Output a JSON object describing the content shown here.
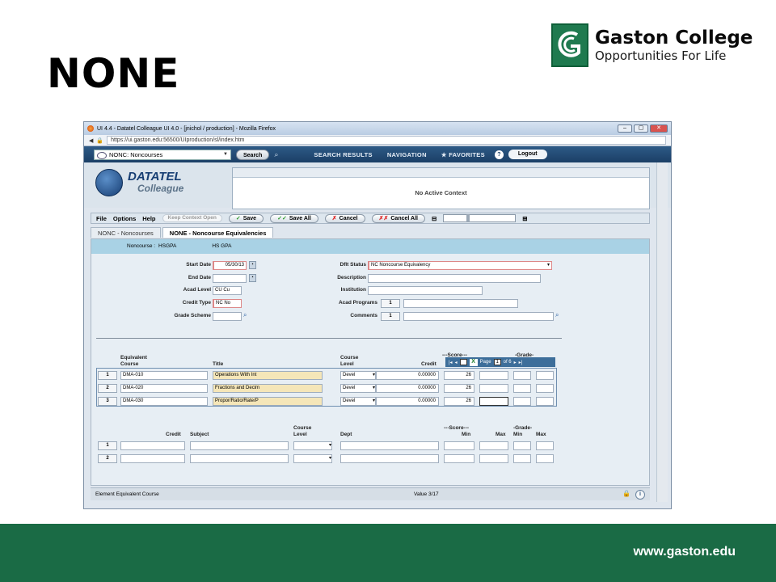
{
  "slide": {
    "title": "NONE",
    "logo_name": "Gaston College",
    "logo_tagline": "Opportunities For Life",
    "footer_url": "www.gaston.edu"
  },
  "browser": {
    "window_title": "UI 4.4 - Datatel Colleague UI 4.0 - [jnichol / production] - Mozilla Firefox",
    "url": "https://ui.gaston.edu:56500/UIproduction/sl/index.htm"
  },
  "appbar": {
    "mnemonic_value": "NONC: Noncourses",
    "search_label": "Search",
    "search_results": "SEARCH RESULTS",
    "navigation": "NAVIGATION",
    "favorites": "FAVORITES",
    "logout": "Logout"
  },
  "branding": {
    "datatel": "DATATEL",
    "colleague": "Colleague",
    "context": "No Active Context"
  },
  "menu": {
    "file": "File",
    "options": "Options",
    "help": "Help",
    "keep_context": "Keep Context Open",
    "save": "Save",
    "save_all": "Save All",
    "cancel": "Cancel",
    "cancel_all": "Cancel All"
  },
  "tabs": [
    "NONC - Noncourses",
    "NONE - Noncourse Equivalencies"
  ],
  "record": {
    "label": "Noncourse :",
    "code": "HSGPA",
    "desc": "HS GPA"
  },
  "fields": {
    "start_date_label": "Start Date",
    "start_date": "05/30/13",
    "end_date_label": "End Date",
    "end_date": "",
    "acad_level_label": "Acad Level",
    "acad_level": "CU Cu",
    "credit_type_label": "Credit Type",
    "credit_type": "NC No",
    "grade_scheme_label": "Grade Scheme",
    "grade_scheme": "",
    "dflt_status_label": "Dflt Status",
    "dflt_status": "NC Noncourse Equivalency",
    "description_label": "Description",
    "description": "",
    "institution_label": "Institution",
    "institution": "",
    "acad_programs_label": "Acad Programs",
    "acad_programs_num": "1",
    "comments_label": "Comments",
    "comments_num": "1"
  },
  "grid1": {
    "headers": {
      "equiv": "Equivalent",
      "course": "Course",
      "title": "Title",
      "course2": "Course",
      "level": "Level",
      "credit": "Credit",
      "score": "---Score---",
      "grade": "-Grade-"
    },
    "pager": {
      "page_label": "Page",
      "page": "1",
      "of": "of 6"
    },
    "rows": [
      {
        "num": "1",
        "course": "DMA-010",
        "title": "Operations With Int",
        "level": "Devel",
        "credit": "0.00000",
        "score": "26"
      },
      {
        "num": "2",
        "course": "DMA-020",
        "title": "Fractions and Decim",
        "level": "Devel",
        "credit": "0.00000",
        "score": "26"
      },
      {
        "num": "3",
        "course": "DMA-030",
        "title": "Propor/Ratio/Rate/P",
        "level": "Devel",
        "credit": "0.00000",
        "score": "26"
      }
    ]
  },
  "grid2": {
    "headers": {
      "credit": "Credit",
      "subject": "Subject",
      "course": "Course",
      "level": "Level",
      "dept": "Dept",
      "score": "---Score---",
      "min": "Min",
      "max": "Max",
      "grade": "-Grade-",
      "gmin": "Min",
      "gmax": "Max"
    },
    "rows": [
      {
        "num": "1"
      },
      {
        "num": "2"
      }
    ]
  },
  "status": {
    "left": "Element Equivalent Course",
    "value": "Value 3/17"
  },
  "colors": {
    "footer": "#1a6b45",
    "appbar": "#1b3f66",
    "record_bar": "#a9d2e5"
  }
}
